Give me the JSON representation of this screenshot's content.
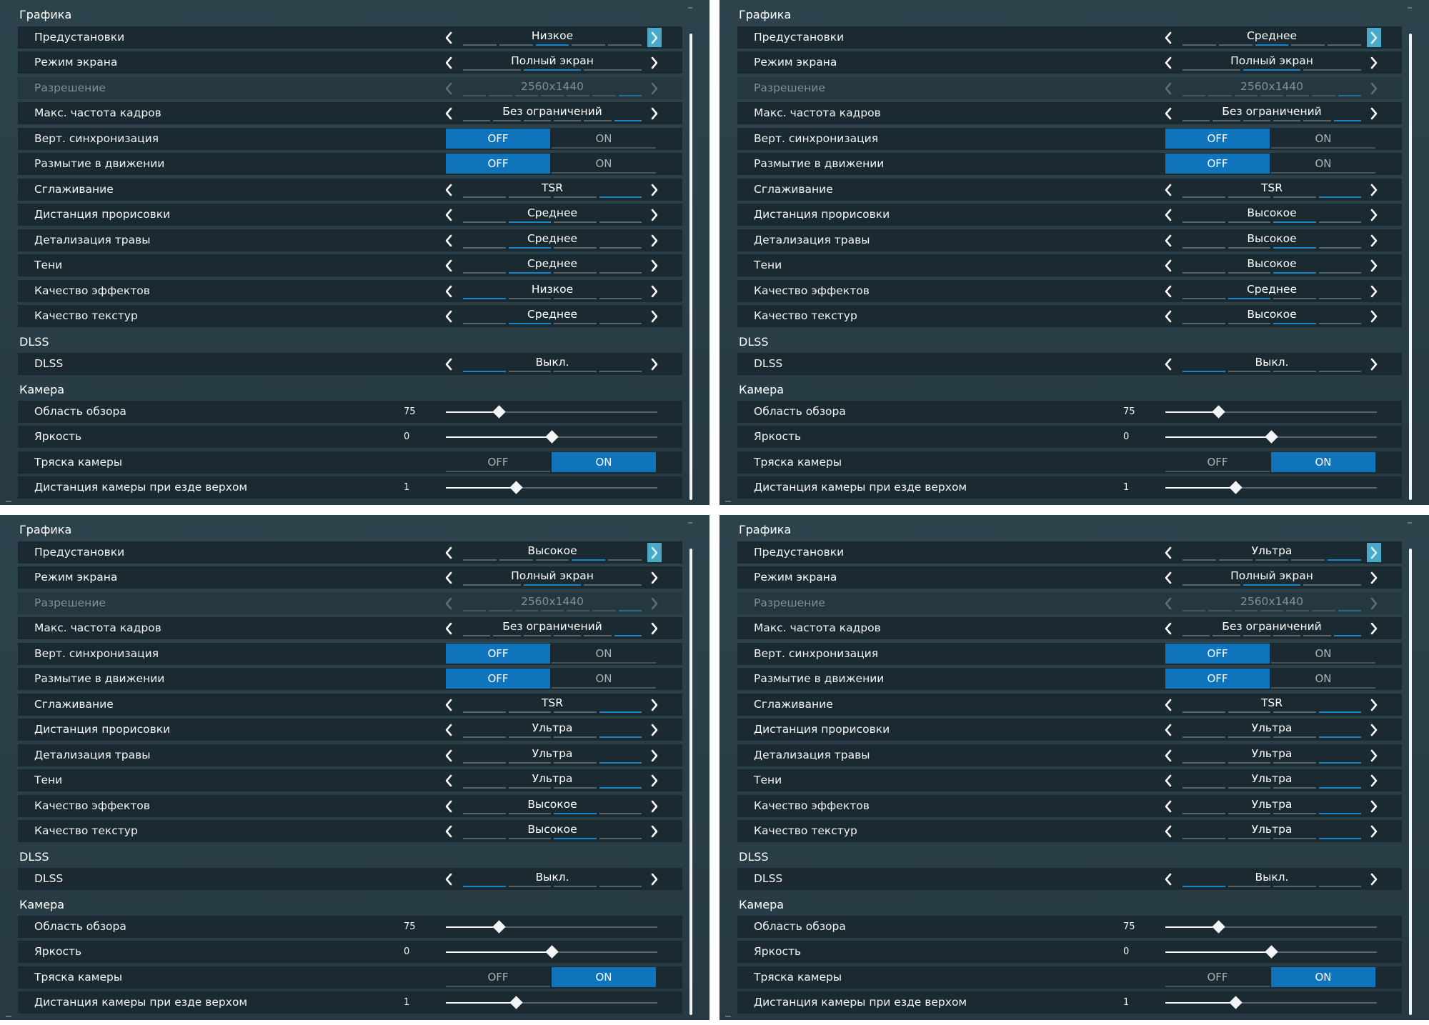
{
  "colors": {
    "panel_bg": "#2b4049",
    "row_bg": "#1b2a31",
    "accent": "#0f74bb",
    "segment_highlight": "#1a84c8",
    "preset_arrow_highlight": "#4aa8c8"
  },
  "icons": {
    "prev": "chevron-left-icon",
    "next": "chevron-right-icon"
  },
  "panels": [
    {
      "sections": {
        "graphics": "Графика",
        "dlss": "DLSS",
        "camera": "Камера"
      },
      "settings": {
        "preset": {
          "label": "Предустановки",
          "value": "Низкое",
          "segments": 5,
          "selected": 2
        },
        "screen_mode": {
          "label": "Режим экрана",
          "value": "Полный экран",
          "segments": 3,
          "selected": 1
        },
        "resolution": {
          "label": "Разрешение",
          "value": "2560x1440",
          "segments": 7,
          "selected": 6,
          "disabled": true
        },
        "max_fps": {
          "label": "Макс. частота кадров",
          "value": "Без ограничений",
          "segments": 6,
          "selected": 5
        },
        "vsync": {
          "label": "Верт. синхронизация",
          "off": "OFF",
          "on": "ON",
          "active": "off"
        },
        "motion_blur": {
          "label": "Размытие в движении",
          "off": "OFF",
          "on": "ON",
          "active": "off"
        },
        "antialiasing": {
          "label": "Сглаживание",
          "value": "TSR",
          "segments": 4,
          "selected": 3
        },
        "draw_distance": {
          "label": "Дистанция прорисовки",
          "value": "Среднее",
          "segments": 4,
          "selected": 1
        },
        "grass_detail": {
          "label": "Детализация травы",
          "value": "Среднее",
          "segments": 4,
          "selected": 1
        },
        "shadows": {
          "label": "Тени",
          "value": "Среднее",
          "segments": 4,
          "selected": 1
        },
        "effects": {
          "label": "Качество эффектов",
          "value": "Низкое",
          "segments": 4,
          "selected": 0
        },
        "textures": {
          "label": "Качество текстур",
          "value": "Среднее",
          "segments": 4,
          "selected": 1
        },
        "dlss": {
          "label": "DLSS",
          "value": "Выкл.",
          "segments": 4,
          "selected": 0
        },
        "fov": {
          "label": "Область обзора",
          "value": "75",
          "fraction": 0.25
        },
        "brightness": {
          "label": "Яркость",
          "value": "0",
          "fraction": 0.5
        },
        "camera_shake": {
          "label": "Тряска камеры",
          "off": "OFF",
          "on": "ON",
          "active": "on"
        },
        "mount_cam_dist": {
          "label": "Дистанция камеры при езде верхом",
          "value": "1",
          "fraction": 0.33
        }
      }
    },
    {
      "sections": {
        "graphics": "Графика",
        "dlss": "DLSS",
        "camera": "Камера"
      },
      "settings": {
        "preset": {
          "label": "Предустановки",
          "value": "Среднее",
          "segments": 5,
          "selected": 2
        },
        "screen_mode": {
          "label": "Режим экрана",
          "value": "Полный экран",
          "segments": 3,
          "selected": 1
        },
        "resolution": {
          "label": "Разрешение",
          "value": "2560x1440",
          "segments": 7,
          "selected": 6,
          "disabled": true
        },
        "max_fps": {
          "label": "Макс. частота кадров",
          "value": "Без ограничений",
          "segments": 6,
          "selected": 5
        },
        "vsync": {
          "label": "Верт. синхронизация",
          "off": "OFF",
          "on": "ON",
          "active": "off"
        },
        "motion_blur": {
          "label": "Размытие в движении",
          "off": "OFF",
          "on": "ON",
          "active": "off"
        },
        "antialiasing": {
          "label": "Сглаживание",
          "value": "TSR",
          "segments": 4,
          "selected": 3
        },
        "draw_distance": {
          "label": "Дистанция прорисовки",
          "value": "Высокое",
          "segments": 4,
          "selected": 2
        },
        "grass_detail": {
          "label": "Детализация травы",
          "value": "Высокое",
          "segments": 4,
          "selected": 2
        },
        "shadows": {
          "label": "Тени",
          "value": "Высокое",
          "segments": 4,
          "selected": 2
        },
        "effects": {
          "label": "Качество эффектов",
          "value": "Среднее",
          "segments": 4,
          "selected": 1
        },
        "textures": {
          "label": "Качество текстур",
          "value": "Высокое",
          "segments": 4,
          "selected": 2
        },
        "dlss": {
          "label": "DLSS",
          "value": "Выкл.",
          "segments": 4,
          "selected": 0
        },
        "fov": {
          "label": "Область обзора",
          "value": "75",
          "fraction": 0.25
        },
        "brightness": {
          "label": "Яркость",
          "value": "0",
          "fraction": 0.5
        },
        "camera_shake": {
          "label": "Тряска камеры",
          "off": "OFF",
          "on": "ON",
          "active": "on"
        },
        "mount_cam_dist": {
          "label": "Дистанция камеры при езде верхом",
          "value": "1",
          "fraction": 0.33
        }
      }
    },
    {
      "sections": {
        "graphics": "Графика",
        "dlss": "DLSS",
        "camera": "Камера"
      },
      "settings": {
        "preset": {
          "label": "Предустановки",
          "value": "Высокое",
          "segments": 5,
          "selected": 3
        },
        "screen_mode": {
          "label": "Режим экрана",
          "value": "Полный экран",
          "segments": 3,
          "selected": 1
        },
        "resolution": {
          "label": "Разрешение",
          "value": "2560x1440",
          "segments": 7,
          "selected": 6,
          "disabled": true
        },
        "max_fps": {
          "label": "Макс. частота кадров",
          "value": "Без ограничений",
          "segments": 6,
          "selected": 5
        },
        "vsync": {
          "label": "Верт. синхронизация",
          "off": "OFF",
          "on": "ON",
          "active": "off"
        },
        "motion_blur": {
          "label": "Размытие в движении",
          "off": "OFF",
          "on": "ON",
          "active": "off"
        },
        "antialiasing": {
          "label": "Сглаживание",
          "value": "TSR",
          "segments": 4,
          "selected": 3
        },
        "draw_distance": {
          "label": "Дистанция прорисовки",
          "value": "Ультра",
          "segments": 4,
          "selected": 3
        },
        "grass_detail": {
          "label": "Детализация травы",
          "value": "Ультра",
          "segments": 4,
          "selected": 3
        },
        "shadows": {
          "label": "Тени",
          "value": "Ультра",
          "segments": 4,
          "selected": 3
        },
        "effects": {
          "label": "Качество эффектов",
          "value": "Высокое",
          "segments": 4,
          "selected": 2
        },
        "textures": {
          "label": "Качество текстур",
          "value": "Высокое",
          "segments": 4,
          "selected": 2
        },
        "dlss": {
          "label": "DLSS",
          "value": "Выкл.",
          "segments": 4,
          "selected": 0
        },
        "fov": {
          "label": "Область обзора",
          "value": "75",
          "fraction": 0.25
        },
        "brightness": {
          "label": "Яркость",
          "value": "0",
          "fraction": 0.5
        },
        "camera_shake": {
          "label": "Тряска камеры",
          "off": "OFF",
          "on": "ON",
          "active": "on"
        },
        "mount_cam_dist": {
          "label": "Дистанция камеры при езде верхом",
          "value": "1",
          "fraction": 0.33
        }
      }
    },
    {
      "sections": {
        "graphics": "Графика",
        "dlss": "DLSS",
        "camera": "Камера"
      },
      "settings": {
        "preset": {
          "label": "Предустановки",
          "value": "Ультра",
          "segments": 5,
          "selected": 4
        },
        "screen_mode": {
          "label": "Режим экрана",
          "value": "Полный экран",
          "segments": 3,
          "selected": 1
        },
        "resolution": {
          "label": "Разрешение",
          "value": "2560x1440",
          "segments": 7,
          "selected": 6,
          "disabled": true
        },
        "max_fps": {
          "label": "Макс. частота кадров",
          "value": "Без ограничений",
          "segments": 6,
          "selected": 5
        },
        "vsync": {
          "label": "Верт. синхронизация",
          "off": "OFF",
          "on": "ON",
          "active": "off"
        },
        "motion_blur": {
          "label": "Размытие в движении",
          "off": "OFF",
          "on": "ON",
          "active": "off"
        },
        "antialiasing": {
          "label": "Сглаживание",
          "value": "TSR",
          "segments": 4,
          "selected": 3
        },
        "draw_distance": {
          "label": "Дистанция прорисовки",
          "value": "Ультра",
          "segments": 4,
          "selected": 3
        },
        "grass_detail": {
          "label": "Детализация травы",
          "value": "Ультра",
          "segments": 4,
          "selected": 3
        },
        "shadows": {
          "label": "Тени",
          "value": "Ультра",
          "segments": 4,
          "selected": 3
        },
        "effects": {
          "label": "Качество эффектов",
          "value": "Ультра",
          "segments": 4,
          "selected": 3
        },
        "textures": {
          "label": "Качество текстур",
          "value": "Ультра",
          "segments": 4,
          "selected": 3
        },
        "dlss": {
          "label": "DLSS",
          "value": "Выкл.",
          "segments": 4,
          "selected": 0
        },
        "fov": {
          "label": "Область обзора",
          "value": "75",
          "fraction": 0.25
        },
        "brightness": {
          "label": "Яркость",
          "value": "0",
          "fraction": 0.5
        },
        "camera_shake": {
          "label": "Тряска камеры",
          "off": "OFF",
          "on": "ON",
          "active": "on"
        },
        "mount_cam_dist": {
          "label": "Дистанция камеры при езде верхом",
          "value": "1",
          "fraction": 0.33
        }
      }
    }
  ]
}
